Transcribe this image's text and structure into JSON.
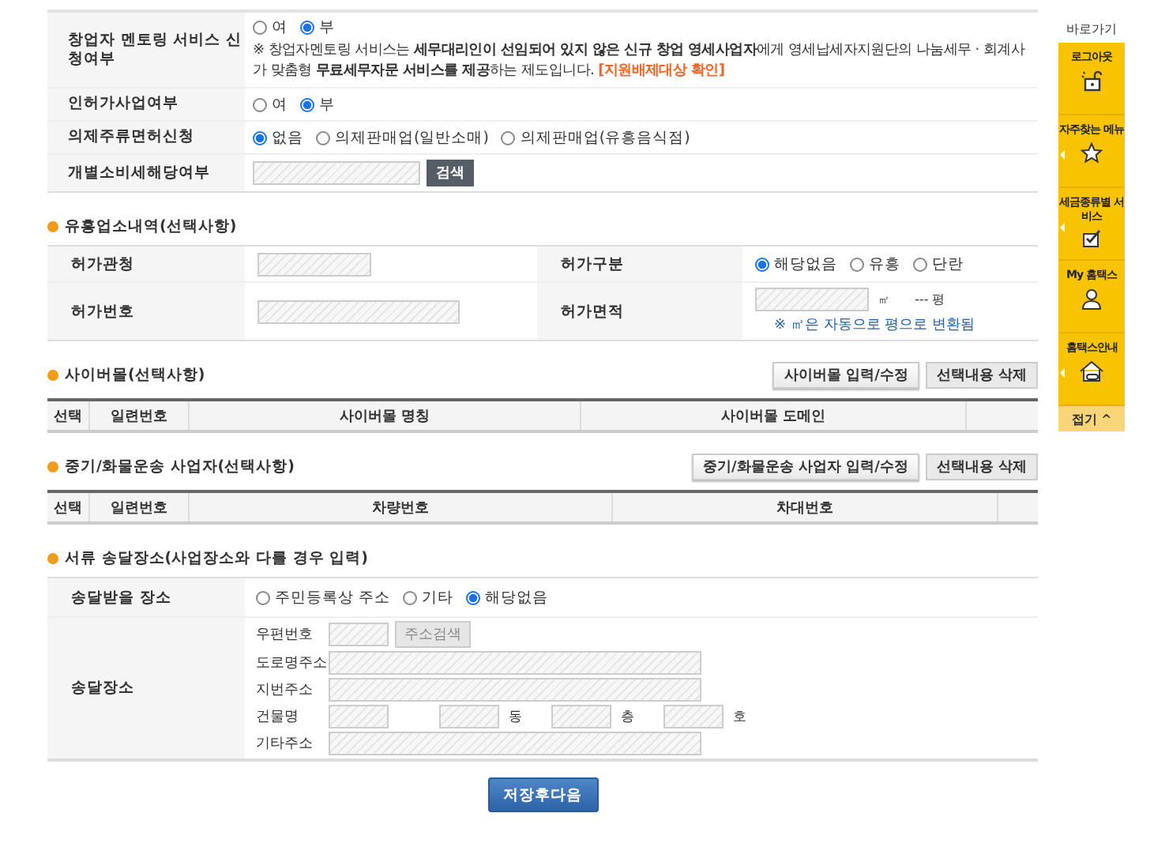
{
  "top_rows": [
    {
      "label": "창업자 멘토링 서비스 신청여부",
      "kind": "radio",
      "options": [
        {
          "label": "여",
          "selected": false
        },
        {
          "label": "부",
          "selected": true
        }
      ],
      "note": {
        "text": "※ 창업자멘토링 서비스는 **세무대리인이 선임되어 있지 않은 신규 창업 영세사업자**에게 영세납세자지원단의 나눔세무 · 회계사가 맞춤형 **무료세무자문 서비스를 제공**하는 제도입니다.",
        "link": "[지원배제대상 확인]"
      }
    },
    {
      "label": "인허가사업여부",
      "kind": "radio",
      "options": [
        {
          "label": "여",
          "selected": false
        },
        {
          "label": "부",
          "selected": true
        }
      ]
    },
    {
      "label": "의제주류면허신청",
      "kind": "radio",
      "options": [
        {
          "label": "없음",
          "selected": true
        },
        {
          "label": "의제판매업(일반소매)",
          "selected": false
        },
        {
          "label": "의제판매업(유흥음식점)",
          "selected": false
        }
      ]
    },
    {
      "label": "개별소비세해당여부",
      "kind": "search",
      "field": {
        "disabled": true
      },
      "button": "검색"
    }
  ],
  "entertainment": {
    "title": "유흥업소내역(선택사항)",
    "rows": [
      {
        "cells": [
          {
            "label": "허가관청",
            "kind": "field",
            "field": {
              "disabled": true
            }
          },
          {
            "label": "허가구분",
            "kind": "radio",
            "options": [
              {
                "label": "해당없음",
                "selected": true
              },
              {
                "label": "유흥",
                "selected": false
              },
              {
                "label": "단란",
                "selected": false
              }
            ]
          }
        ]
      },
      {
        "cells": [
          {
            "label": "허가번호",
            "kind": "wide_field",
            "field": {
              "disabled": true
            }
          },
          {
            "label": "허가면적",
            "kind": "area",
            "field": {
              "disabled": true
            },
            "unit": "㎡",
            "converted": "--- 평",
            "note": "※ ㎡은 자동으로 평으로 변환됨"
          }
        ]
      }
    ]
  },
  "cyber_mall": {
    "title": "사이버몰(선택사항)",
    "buttons": [
      {
        "label": "사이버몰 입력/수정",
        "kind": "raised"
      },
      {
        "label": "선택내용 삭제",
        "kind": "flat"
      }
    ],
    "columns": [
      "선택",
      "일련번호",
      "사이버몰 명칭",
      "사이버몰 도메인"
    ]
  },
  "freight": {
    "title": "중기/화물운송 사업자(선택사항)",
    "buttons": [
      {
        "label": "중기/화물운송 사업자 입력/수정",
        "kind": "raised"
      },
      {
        "label": "선택내용 삭제",
        "kind": "flat"
      }
    ],
    "columns": [
      "선택",
      "일련번호",
      "차량번호",
      "차대번호"
    ]
  },
  "delivery": {
    "title": "서류 송달장소(사업장소와 다를 경우 입력)",
    "place_label": "송달받을 장소",
    "options": [
      {
        "label": "주민등록상 주소",
        "selected": false
      },
      {
        "label": "기타",
        "selected": false
      },
      {
        "label": "해당없음",
        "selected": true
      }
    ],
    "address_label": "송달장소",
    "lines": [
      {
        "label": "우편번호",
        "parts": [
          {
            "kind": "short_field",
            "disabled": true
          },
          {
            "kind": "button",
            "label": "주소검색",
            "disabled": true
          }
        ]
      },
      {
        "label": "도로명주소",
        "parts": [
          {
            "kind": "long_field",
            "disabled": true
          }
        ]
      },
      {
        "label": "지번주소",
        "parts": [
          {
            "kind": "long_field",
            "disabled": true
          }
        ]
      },
      {
        "label": "건물명",
        "parts": [
          {
            "kind": "unit_field",
            "disabled": true
          },
          {
            "kind": "gap"
          },
          {
            "kind": "unit_field",
            "disabled": true
          },
          {
            "kind": "unit",
            "text": "동"
          },
          {
            "kind": "unit_field",
            "disabled": true
          },
          {
            "kind": "unit",
            "text": "층"
          },
          {
            "kind": "unit_field",
            "disabled": true
          },
          {
            "kind": "unit",
            "text": "호"
          }
        ]
      },
      {
        "label": "기타주소",
        "parts": [
          {
            "kind": "long_field",
            "disabled": true
          }
        ]
      }
    ]
  },
  "next_button": "저장후다음",
  "quick_menu": {
    "title": "바로가기",
    "items": [
      {
        "label": "로그아웃",
        "arrow": false
      },
      {
        "label": "자주찾는 메뉴",
        "arrow": true
      },
      {
        "label": "세금종류별 서비스",
        "arrow": true
      },
      {
        "label": "My 홈택스",
        "arrow": false
      },
      {
        "label": "홈택스안내",
        "arrow": true
      }
    ],
    "collapse": "접기 ^"
  }
}
